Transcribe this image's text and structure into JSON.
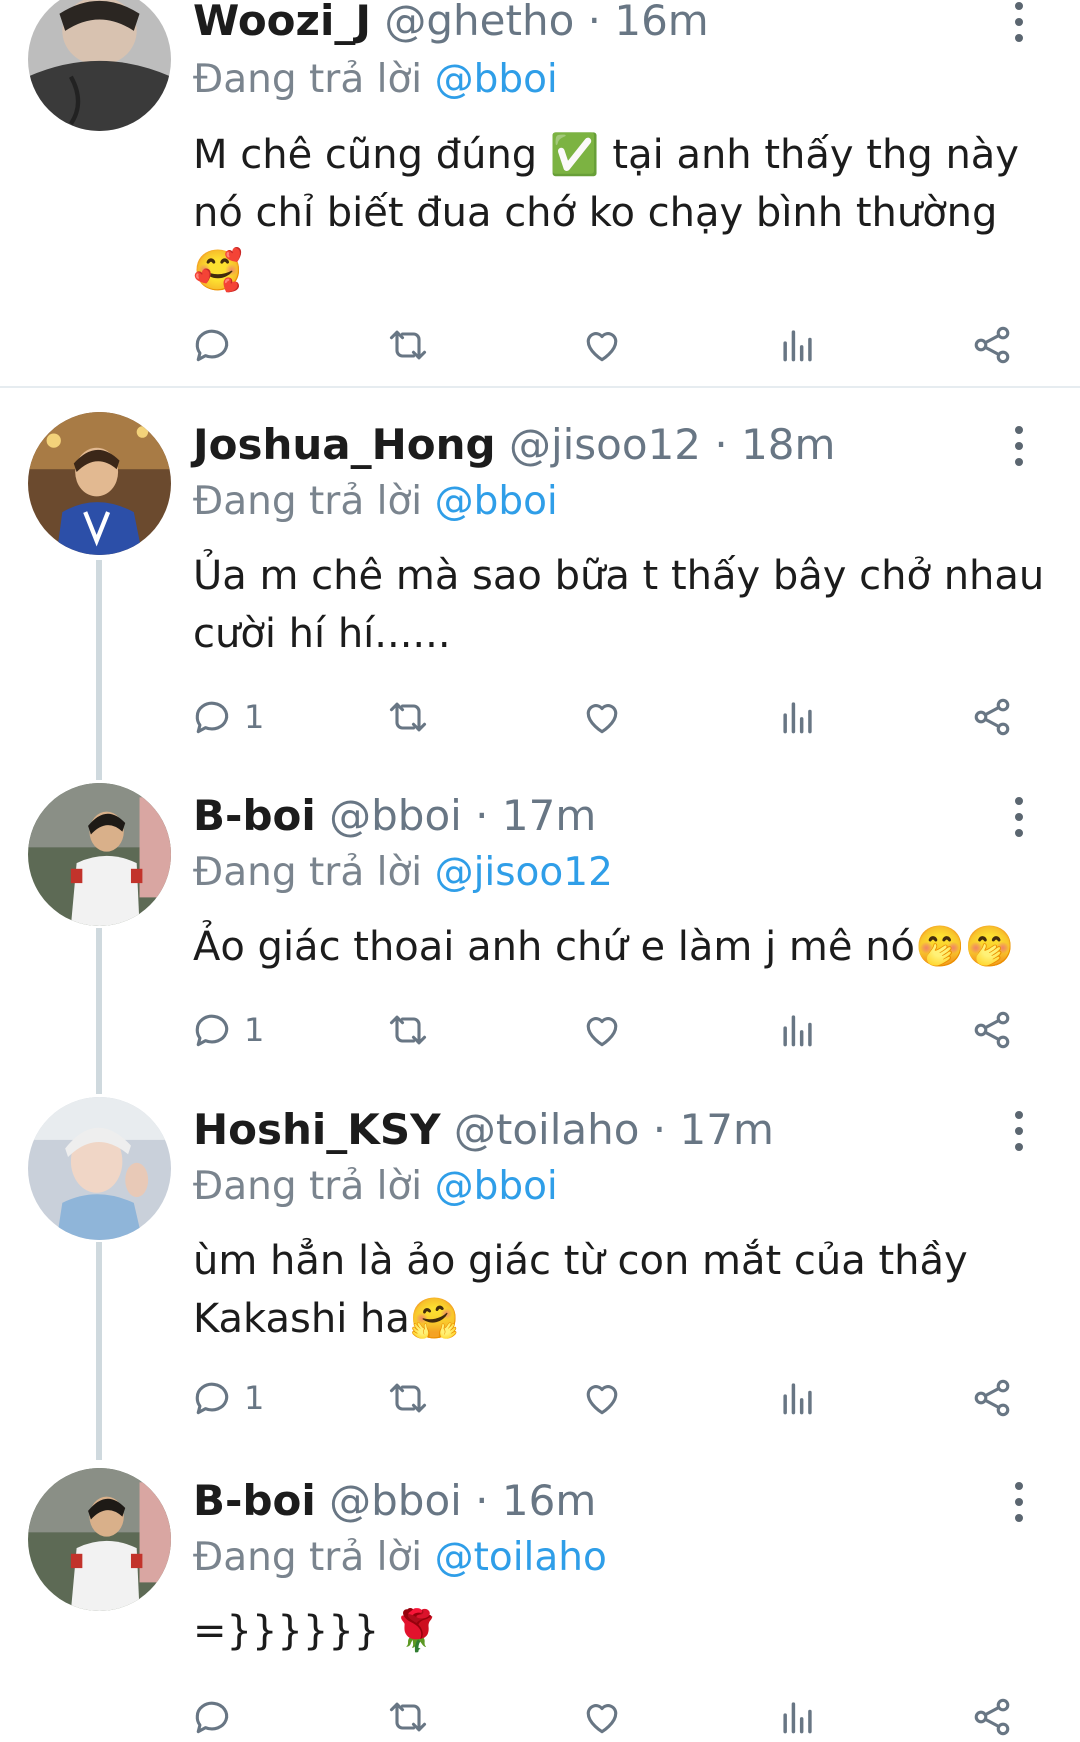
{
  "reply_prefix": "Đang trả lời",
  "colors": {
    "accent": "#2f9ee8",
    "muted": "#687684",
    "thread_line": "#cfd9de"
  },
  "tweets": [
    {
      "name": "Woozi_J",
      "handle": "@ghetho",
      "time": "16m",
      "reply_to": "@bboi",
      "text": "M chê cũng đúng ✅ tại anh thấy thg này nó chỉ biết đua chớ ko chạy bình thường 🥰",
      "reply_count": ""
    },
    {
      "name": "Joshua_Hong",
      "handle": "@jisoo12",
      "time": "18m",
      "reply_to": "@bboi",
      "text": "Ủa m chê mà sao bữa t thấy bây chở nhau cười hí hí......",
      "reply_count": "1"
    },
    {
      "name": "B-boi",
      "handle": "@bboi",
      "time": "17m",
      "reply_to": "@jisoo12",
      "text": "Ảo giác thoai anh chứ e làm j mê nó🤭🤭",
      "reply_count": "1"
    },
    {
      "name": "Hoshi_KSY",
      "handle": "@toilaho",
      "time": "17m",
      "reply_to": "@bboi",
      "text": "ùm hẳn là ảo giác từ con mắt của thầy Kakashi ha🤗",
      "reply_count": "1"
    },
    {
      "name": "B-boi",
      "handle": "@bboi",
      "time": "16m",
      "reply_to": "@toilaho",
      "text": "=}}}}}} 🌹",
      "reply_count": ""
    }
  ],
  "icons": {
    "reply": "reply-icon",
    "retweet": "retweet-icon",
    "like": "heart-icon",
    "views": "views-icon",
    "share": "share-icon",
    "more": "more-icon"
  }
}
